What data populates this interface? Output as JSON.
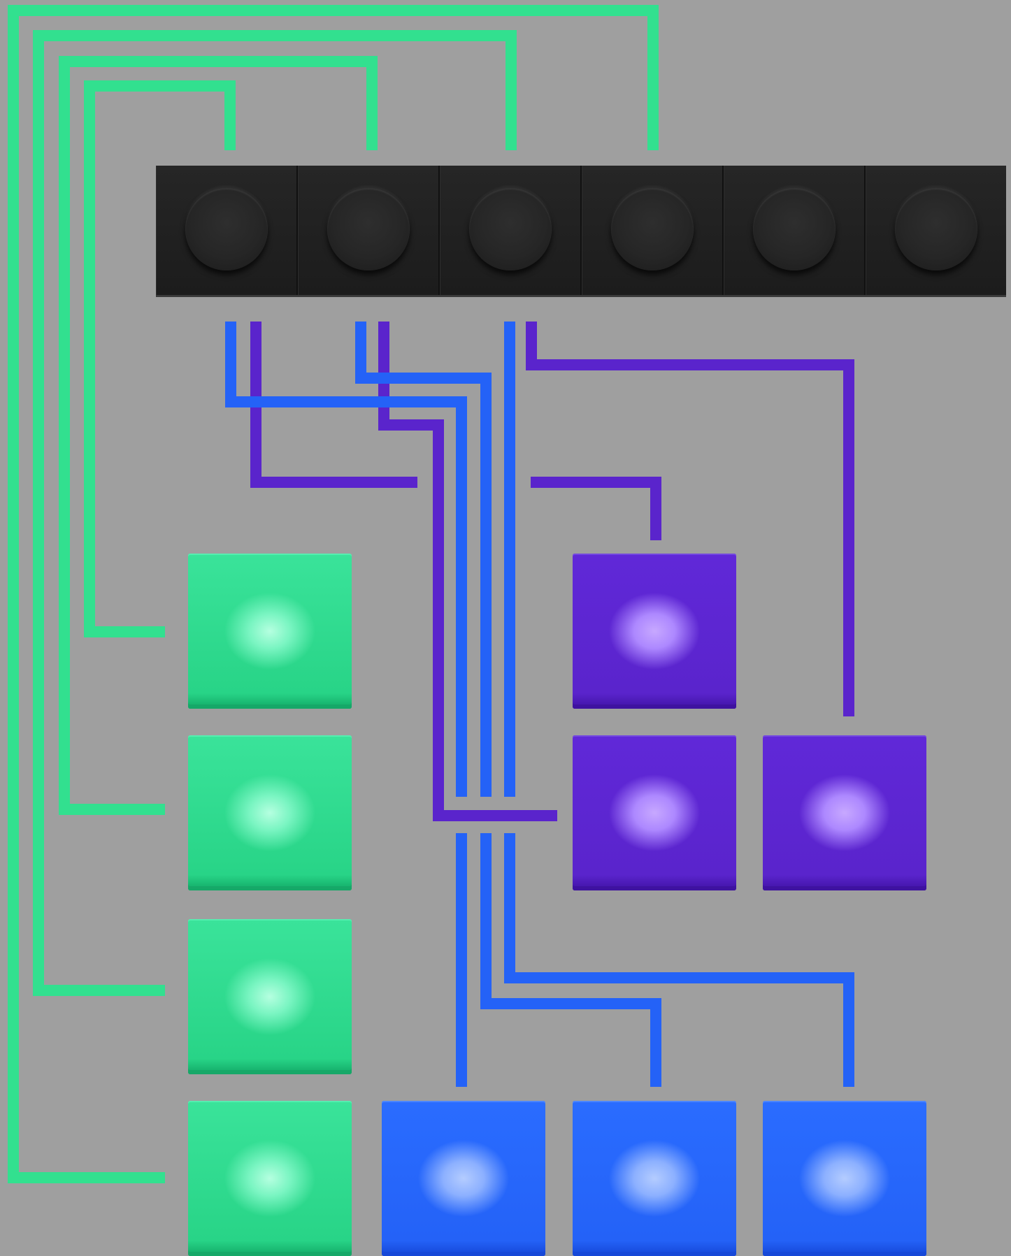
{
  "palette": {
    "background": "#9f9f9f",
    "green": "#32e08f",
    "purple": "#5a24cc",
    "blue": "#2462f7",
    "button_strip": "#1e1e1e"
  },
  "button_strip": {
    "button_count": 6,
    "buttons": [
      {
        "id": "button-1"
      },
      {
        "id": "button-2"
      },
      {
        "id": "button-3"
      },
      {
        "id": "button-4"
      },
      {
        "id": "button-5"
      },
      {
        "id": "button-6"
      }
    ]
  },
  "pads": [
    {
      "id": "green-pad-1",
      "color": "green"
    },
    {
      "id": "green-pad-2",
      "color": "green"
    },
    {
      "id": "green-pad-3",
      "color": "green"
    },
    {
      "id": "green-pad-4",
      "color": "green"
    },
    {
      "id": "purple-pad-1",
      "color": "purple"
    },
    {
      "id": "purple-pad-2",
      "color": "purple"
    },
    {
      "id": "purple-pad-3",
      "color": "purple"
    },
    {
      "id": "blue-pad-1",
      "color": "blue"
    },
    {
      "id": "blue-pad-2",
      "color": "blue"
    },
    {
      "id": "blue-pad-3",
      "color": "blue"
    }
  ],
  "connections": [
    {
      "color": "green",
      "from": "button-1",
      "to": "green-pad-1"
    },
    {
      "color": "green",
      "from": "button-2",
      "to": "green-pad-2"
    },
    {
      "color": "green",
      "from": "button-3",
      "to": "green-pad-3"
    },
    {
      "color": "green",
      "from": "button-4",
      "to": "green-pad-4"
    },
    {
      "color": "purple",
      "from": "button-1",
      "to": "purple-pad-1"
    },
    {
      "color": "purple",
      "from": "button-2",
      "to": "purple-pad-2"
    },
    {
      "color": "purple",
      "from": "button-3",
      "to": "purple-pad-3"
    },
    {
      "color": "blue",
      "from": "button-1",
      "to": "blue-pad-1"
    },
    {
      "color": "blue",
      "from": "button-2",
      "to": "blue-pad-2"
    },
    {
      "color": "blue",
      "from": "button-3",
      "to": "blue-pad-3"
    }
  ]
}
